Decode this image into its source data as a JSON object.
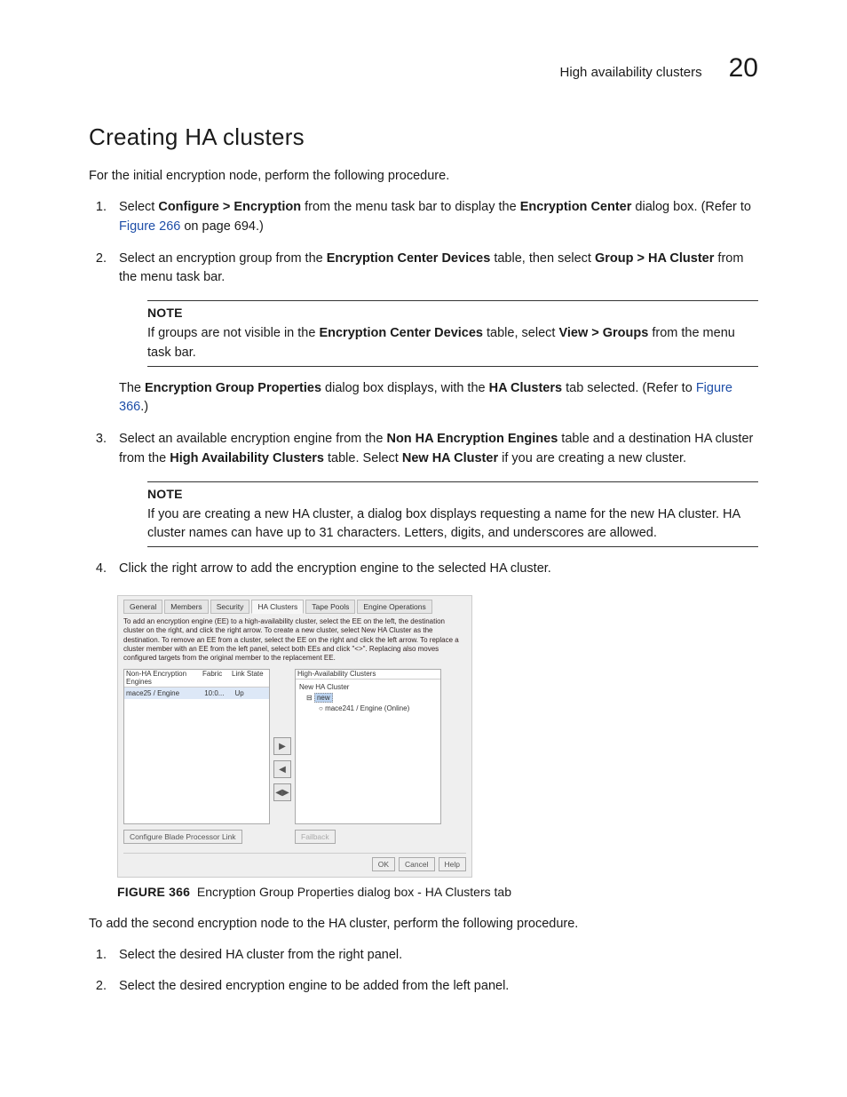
{
  "header": {
    "running_head": "High availability clusters",
    "chapter_num": "20"
  },
  "section": {
    "title": "Creating HA clusters",
    "intro": "For the initial encryption node, perform the following procedure."
  },
  "step1": {
    "pre": "Select ",
    "bold1": "Configure > Encryption",
    "mid": " from the menu task bar to display the ",
    "bold2": "Encryption Center",
    "post": " dialog box. (Refer to ",
    "link": "Figure 266",
    "tail": " on page 694.)"
  },
  "step2": {
    "pre": "Select an encryption group from the ",
    "bold1": "Encryption Center Devices",
    "mid": " table, then select ",
    "bold2": "Group > HA Cluster",
    "post": " from the menu task bar."
  },
  "note1": {
    "head": "NOTE",
    "pre": "If groups are not visible in the ",
    "bold1": "Encryption Center Devices",
    "mid": " table, select ",
    "bold2": "View > Groups",
    "post": " from the menu task bar."
  },
  "subpara1": {
    "pre": "The ",
    "bold1": "Encryption Group Properties",
    "mid": " dialog box displays, with the ",
    "bold2": "HA Clusters",
    "post1": " tab selected. (Refer to ",
    "link": "Figure 366",
    "post2": ".)"
  },
  "step3": {
    "pre": "Select an available encryption engine from the ",
    "bold1": "Non HA Encryption Engines",
    "mid": " table and a destination HA cluster from the ",
    "bold2": "High Availability Clusters",
    "post1": " table. Select ",
    "bold3": "New HA Cluster",
    "post2": " if you are creating a new cluster."
  },
  "note2": {
    "head": "NOTE",
    "body": "If you are creating a new HA cluster, a dialog box displays requesting a name for the new HA cluster. HA cluster names can have up to 31 characters. Letters, digits, and underscores are allowed."
  },
  "step4": {
    "text": "Click the right arrow to add the encryption engine to the selected HA cluster."
  },
  "dialog": {
    "tabs": [
      "General",
      "Members",
      "Security",
      "HA Clusters",
      "Tape Pools",
      "Engine Operations"
    ],
    "active_tab_index": 3,
    "instruction": "To add an encryption engine (EE) to a high-availability cluster, select the EE on the left, the destination cluster on the right, and click the right arrow. To create a new cluster, select New HA Cluster as the destination. To remove an EE from a cluster, select the EE on the right and click the left arrow. To replace a cluster member with an EE from the left panel, select both EEs and click \"<>\". Replacing also moves configured targets from the original member to the replacement EE.",
    "left_title": "Non-HA Encryption Engines",
    "left_cols": [
      "Fabric",
      "Link State"
    ],
    "left_row": {
      "name": "mace25 / Engine",
      "fabric": "10:0...",
      "state": "Up"
    },
    "right_title": "High-Availability Clusters",
    "tree_root": "New HA Cluster",
    "tree_sel": "new",
    "tree_leaf": "mace241 / Engine (Online)",
    "btn_configure": "Configure Blade Processor Link",
    "btn_failback": "Failback",
    "ok": "OK",
    "cancel": "Cancel",
    "help": "Help"
  },
  "figcap": {
    "label": "FIGURE 366",
    "text": "Encryption Group Properties dialog box - HA Clusters tab"
  },
  "second_proc": {
    "intro": "To add the second encryption node to the HA cluster, perform the following procedure.",
    "s1": "Select the desired HA cluster from the right panel.",
    "s2": "Select the desired encryption engine to be added from the left panel."
  }
}
